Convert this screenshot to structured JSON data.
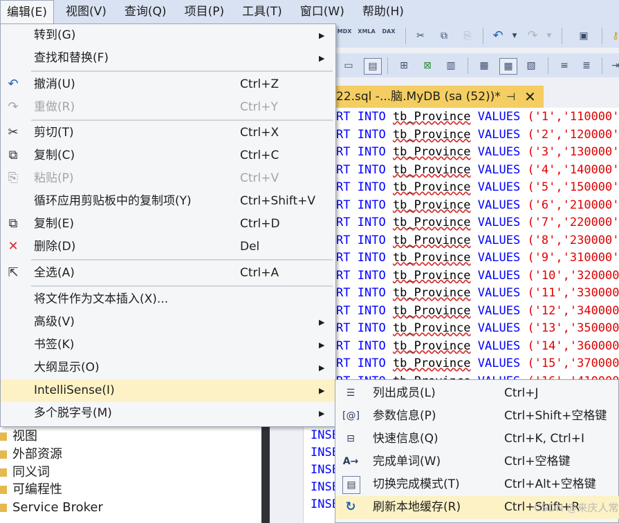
{
  "menubar": [
    {
      "label": "编辑(E)",
      "active": true
    },
    {
      "label": "视图(V)"
    },
    {
      "label": "查询(Q)"
    },
    {
      "label": "项目(P)"
    },
    {
      "label": "工具(T)"
    },
    {
      "label": "窗口(W)"
    },
    {
      "label": "帮助(H)"
    }
  ],
  "toolbar": {
    "mdx_label": "MDX",
    "xmla_label": "XMLA",
    "dax_label": "DAX"
  },
  "document_tab": {
    "title": "22.sql -...脑.MyDB (sa (52))*",
    "pin": "⊣",
    "close": "✕"
  },
  "code_lines": [
    {
      "prefix": "RT",
      "kw1": "INTO",
      "table": "tb_Province",
      "kw2": "VALUES",
      "values": "('1','110000'"
    },
    {
      "prefix": "RT",
      "kw1": "INTO",
      "table": "tb_Province",
      "kw2": "VALUES",
      "values": "('2','120000'"
    },
    {
      "prefix": "RT",
      "kw1": "INTO",
      "table": "tb_Province",
      "kw2": "VALUES",
      "values": "('3','130000'"
    },
    {
      "prefix": "RT",
      "kw1": "INTO",
      "table": "tb_Province",
      "kw2": "VALUES",
      "values": "('4','140000'"
    },
    {
      "prefix": "RT",
      "kw1": "INTO",
      "table": "tb_Province",
      "kw2": "VALUES",
      "values": "('5','150000'"
    },
    {
      "prefix": "RT",
      "kw1": "INTO",
      "table": "tb_Province",
      "kw2": "VALUES",
      "values": "('6','210000'"
    },
    {
      "prefix": "RT",
      "kw1": "INTO",
      "table": "tb_Province",
      "kw2": "VALUES",
      "values": "('7','220000'"
    },
    {
      "prefix": "RT",
      "kw1": "INTO",
      "table": "tb_Province",
      "kw2": "VALUES",
      "values": "('8','230000'"
    },
    {
      "prefix": "RT",
      "kw1": "INTO",
      "table": "tb_Province",
      "kw2": "VALUES",
      "values": "('9','310000'"
    },
    {
      "prefix": "RT",
      "kw1": "INTO",
      "table": "tb_Province",
      "kw2": "VALUES",
      "values": "('10','320000"
    },
    {
      "prefix": "RT",
      "kw1": "INTO",
      "table": "tb_Province",
      "kw2": "VALUES",
      "values": "('11','330000"
    },
    {
      "prefix": "RT",
      "kw1": "INTO",
      "table": "tb_Province",
      "kw2": "VALUES",
      "values": "('12','340000"
    },
    {
      "prefix": "RT",
      "kw1": "INTO",
      "table": "tb_Province",
      "kw2": "VALUES",
      "values": "('13','350000"
    },
    {
      "prefix": "RT",
      "kw1": "INTO",
      "table": "tb_Province",
      "kw2": "VALUES",
      "values": "('14','360000"
    },
    {
      "prefix": "RT",
      "kw1": "INTO",
      "table": "tb_Province",
      "kw2": "VALUES",
      "values": "('15','370000"
    },
    {
      "prefix": "RT",
      "kw1": "INTO",
      "table": "tb_Province",
      "kw2": "VALUES",
      "values": "('16','410000"
    }
  ],
  "lower_code_prefix": "INSE",
  "edit_menu": [
    {
      "label": "转到(G)",
      "shortcut": "",
      "submenu": true,
      "icon": "",
      "disabled": false
    },
    {
      "label": "查找和替换(F)",
      "shortcut": "",
      "submenu": true,
      "icon": "",
      "disabled": false
    },
    {
      "label": "撤消(U)",
      "shortcut": "Ctrl+Z",
      "submenu": false,
      "icon": "undo-icon",
      "disabled": false
    },
    {
      "label": "重做(R)",
      "shortcut": "Ctrl+Y",
      "submenu": false,
      "icon": "redo-icon",
      "disabled": true
    },
    {
      "label": "剪切(T)",
      "shortcut": "Ctrl+X",
      "submenu": false,
      "icon": "cut-icon",
      "disabled": false
    },
    {
      "label": "复制(C)",
      "shortcut": "Ctrl+C",
      "submenu": false,
      "icon": "copy-icon",
      "disabled": false
    },
    {
      "label": "粘贴(P)",
      "shortcut": "Ctrl+V",
      "submenu": false,
      "icon": "paste-icon",
      "disabled": true
    },
    {
      "label": "循环应用剪贴板中的复制项(Y)",
      "shortcut": "Ctrl+Shift+V",
      "submenu": false,
      "icon": "",
      "disabled": false
    },
    {
      "label": "复制(E)",
      "shortcut": "Ctrl+D",
      "submenu": false,
      "icon": "duplicate-icon",
      "disabled": false
    },
    {
      "label": "删除(D)",
      "shortcut": "Del",
      "submenu": false,
      "icon": "delete-icon",
      "disabled": false
    },
    {
      "label": "全选(A)",
      "shortcut": "Ctrl+A",
      "submenu": false,
      "icon": "select-all-icon",
      "disabled": false
    },
    {
      "label": "将文件作为文本插入(X)...",
      "shortcut": "",
      "submenu": false,
      "icon": "",
      "disabled": false
    },
    {
      "label": "高级(V)",
      "shortcut": "",
      "submenu": true,
      "icon": "",
      "disabled": false
    },
    {
      "label": "书签(K)",
      "shortcut": "",
      "submenu": true,
      "icon": "",
      "disabled": false
    },
    {
      "label": "大纲显示(O)",
      "shortcut": "",
      "submenu": true,
      "icon": "",
      "disabled": false
    },
    {
      "label": "IntelliSense(I)",
      "shortcut": "",
      "submenu": true,
      "icon": "",
      "disabled": false,
      "highlighted": true
    },
    {
      "label": "多个脱字号(M)",
      "shortcut": "",
      "submenu": true,
      "icon": "",
      "disabled": false
    }
  ],
  "intellisense_menu": [
    {
      "label": "列出成员(L)",
      "shortcut": "Ctrl+J",
      "icon": "list-members-icon"
    },
    {
      "label": "参数信息(P)",
      "shortcut": "Ctrl+Shift+空格键",
      "icon": "parameter-info-icon"
    },
    {
      "label": "快速信息(Q)",
      "shortcut": "Ctrl+K, Ctrl+I",
      "icon": "quick-info-icon"
    },
    {
      "label": "完成单词(W)",
      "shortcut": "Ctrl+空格键",
      "icon": "complete-word-icon"
    },
    {
      "label": "切换完成模式(T)",
      "shortcut": "Ctrl+Alt+空格键",
      "icon": "toggle-completion-icon"
    },
    {
      "label": "刷新本地缓存(R)",
      "shortcut": "Ctrl+Shift+R",
      "icon": "refresh-icon",
      "highlighted": true
    }
  ],
  "explorer_items": [
    "视图",
    "外部资源",
    "同义词",
    "可编程性",
    "Service Broker"
  ],
  "watermark": "CSDN @来庆人常",
  "colors": {
    "menubar_bg": "#d8e2f3",
    "menu_bg": "#f5f6f8",
    "highlight": "#fdf2c5",
    "tab_active": "#f4ce62",
    "keyword": "#0000ff",
    "string": "#e00000"
  }
}
